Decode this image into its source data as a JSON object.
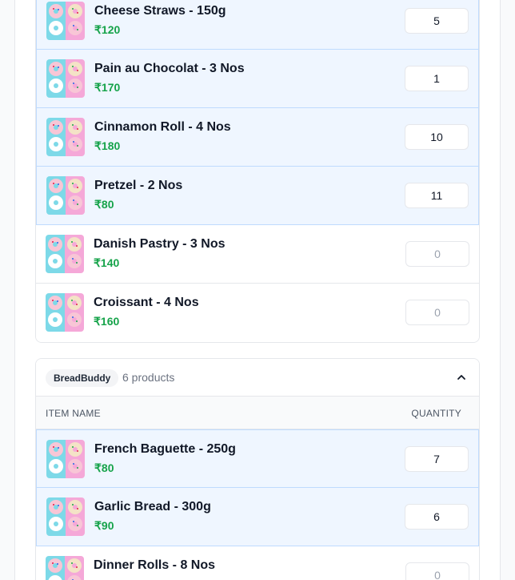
{
  "colors": {
    "price": "#16a34a",
    "selected_row": "#eff6ff",
    "selected_border": "#bfdbfe"
  },
  "previous_group": {
    "items": [
      {
        "name": "Cheese Straws - 150g",
        "price": "₹120",
        "quantity": "5",
        "selected": true,
        "thumb": "donut-thumbnail-icon"
      },
      {
        "name": "Pain au Chocolat - 3 Nos",
        "price": "₹170",
        "quantity": "1",
        "selected": true,
        "thumb": "donut-thumbnail-icon"
      },
      {
        "name": "Cinnamon Roll - 4 Nos",
        "price": "₹180",
        "quantity": "10",
        "selected": true,
        "thumb": "donut-thumbnail-icon"
      },
      {
        "name": "Pretzel - 2 Nos",
        "price": "₹80",
        "quantity": "11",
        "selected": true,
        "thumb": "donut-thumbnail-icon"
      },
      {
        "name": "Danish Pastry - 3 Nos",
        "price": "₹140",
        "quantity": "0",
        "selected": false,
        "thumb": "donut-thumbnail-icon"
      },
      {
        "name": "Croissant - 4 Nos",
        "price": "₹160",
        "quantity": "0",
        "selected": false,
        "thumb": "donut-thumbnail-icon"
      }
    ]
  },
  "breadbuddy_group": {
    "vendor": "BreadBuddy",
    "product_count": "6 products",
    "collapse_icon": "chevron-up-icon",
    "columns": {
      "item_name": "ITEM NAME",
      "quantity": "QUANTITY"
    },
    "items": [
      {
        "name": "French Baguette - 250g",
        "price": "₹80",
        "quantity": "7",
        "selected": true,
        "thumb": "donut-thumbnail-icon"
      },
      {
        "name": "Garlic Bread - 300g",
        "price": "₹90",
        "quantity": "6",
        "selected": true,
        "thumb": "donut-thumbnail-icon"
      },
      {
        "name": "Dinner Rolls - 8 Nos",
        "price": "",
        "quantity": "0",
        "selected": false,
        "thumb": "donut-thumbnail-icon"
      }
    ]
  }
}
